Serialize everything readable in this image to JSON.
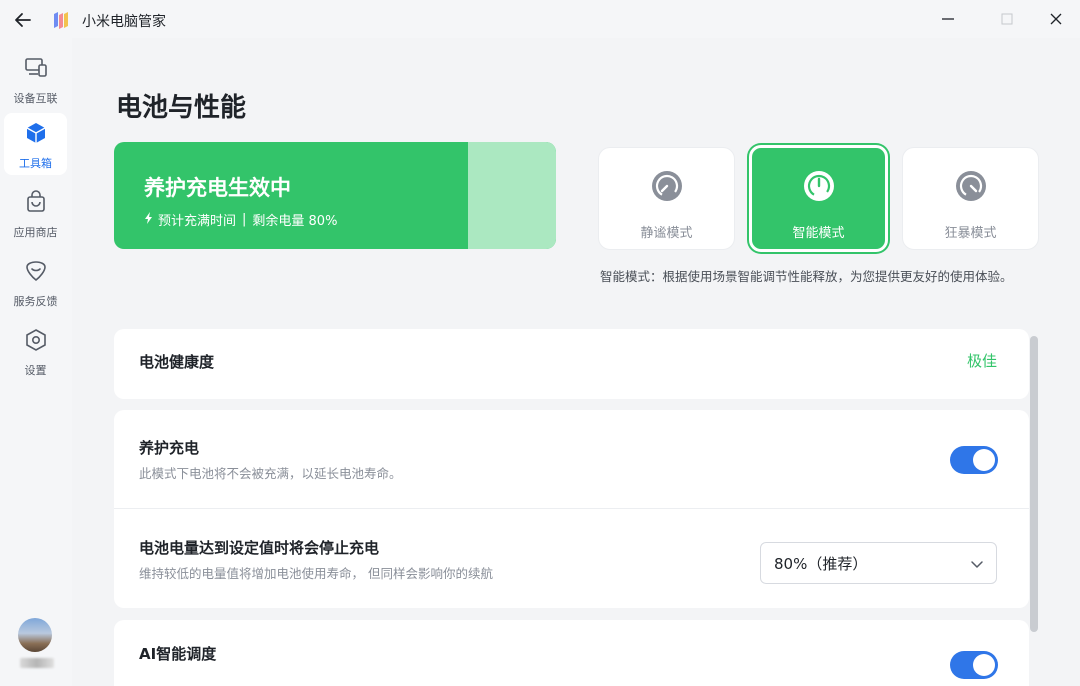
{
  "window": {
    "app_title": "小米电脑管家",
    "back_icon": "arrow-left-icon",
    "minimize_icon": "minimize-icon",
    "maximize_icon": "maximize-icon",
    "close_icon": "close-icon"
  },
  "sidebar": {
    "items": [
      {
        "label": "设备互联",
        "icon": "devices-icon",
        "active": false
      },
      {
        "label": "工具箱",
        "icon": "cube-icon",
        "active": true
      },
      {
        "label": "应用商店",
        "icon": "shopping-bag-icon",
        "active": false
      },
      {
        "label": "服务反馈",
        "icon": "feedback-icon",
        "active": false
      },
      {
        "label": "设置",
        "icon": "settings-icon",
        "active": false
      }
    ]
  },
  "page": {
    "title": "电池与性能"
  },
  "banner": {
    "title": "养护充电生效中",
    "subtitle_left": "预计充满时间",
    "separator": "|",
    "subtitle_right": "剩余电量 80%",
    "battery_level_percent": 80
  },
  "modes": {
    "items": [
      {
        "label": "静谧模式",
        "icon": "gauge-low-icon",
        "active": false
      },
      {
        "label": "智能模式",
        "icon": "gauge-mid-icon",
        "active": true
      },
      {
        "label": "狂暴模式",
        "icon": "gauge-high-icon",
        "active": false
      }
    ],
    "description": "智能模式：根据使用场景智能调节性能释放，为您提供更友好的使用体验。"
  },
  "health": {
    "label": "电池健康度",
    "value": "极佳"
  },
  "care_charging": {
    "title": "养护充电",
    "subtitle": "此模式下电池将不会被充满，以延长电池寿命。",
    "enabled": true
  },
  "charge_limit": {
    "title": "电池电量达到设定值时将会停止充电",
    "subtitle": "维持较低的电量值将增加电池使用寿命， 但同样会影响你的续航",
    "selected": "80%（推荐）"
  },
  "ai_scheduling": {
    "title": "AI智能调度",
    "enabled": true
  },
  "colors": {
    "accent_green": "#33c46a",
    "accent_blue": "#2f76e8",
    "light_green": "#abe8c1"
  }
}
